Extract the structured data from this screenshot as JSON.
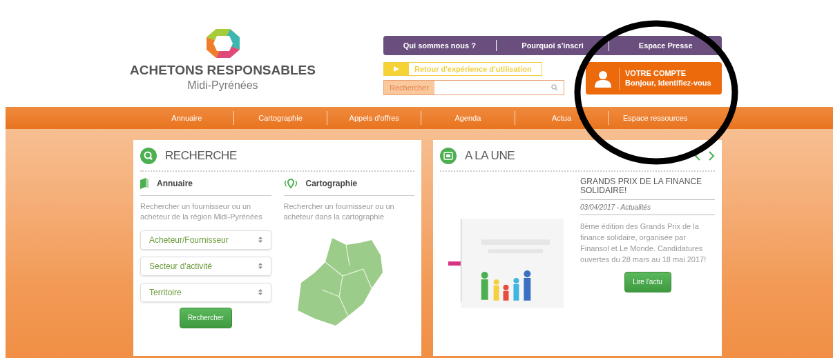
{
  "logo": {
    "title": "ACHETONS RESPONSABLES",
    "subtitle": "Midi-Pyrénées"
  },
  "top_links": [
    "Qui sommes nous ?",
    "Pourquoi s'inscri",
    "Espace Presse"
  ],
  "feedback_button": "Retour d'expérience d'utilisation",
  "search": {
    "label": "Rechercher"
  },
  "account": {
    "title": "VOTRE COMPTE",
    "subtitle": "Bonjour, Identifiez-vous"
  },
  "nav": [
    "Annuaire",
    "Cartographie",
    "Appels d'offres",
    "Agenda",
    "Actua",
    "Espace ressources"
  ],
  "search_panel": {
    "title": "RECHERCHE",
    "directory": {
      "title": "Annuaire",
      "text": "Rechercher un fournisseur ou un acheteur de la région Midi-Pyrénées",
      "selects": [
        "Acheteur/Fournisseur",
        "Secteur d'activité",
        "Territoire"
      ],
      "button": "Rechercher"
    },
    "map": {
      "title": "Cartographie",
      "text": "Rechercher un fournisseur ou un acheteur dans la cartographie"
    }
  },
  "news_panel": {
    "title": "A LA UNE",
    "article": {
      "title": "GRANDS PRIX DE LA FINANCE SOLIDAIRE!",
      "date": "03/04/2017 - Actualités",
      "text": "8ème édition des Grands Prix de la finance solidaire, organisée par Finansol et Le Monde. Candidatures ouvertes du 28 mars au 18 mai 2017!",
      "button": "Lire l'actu"
    }
  }
}
